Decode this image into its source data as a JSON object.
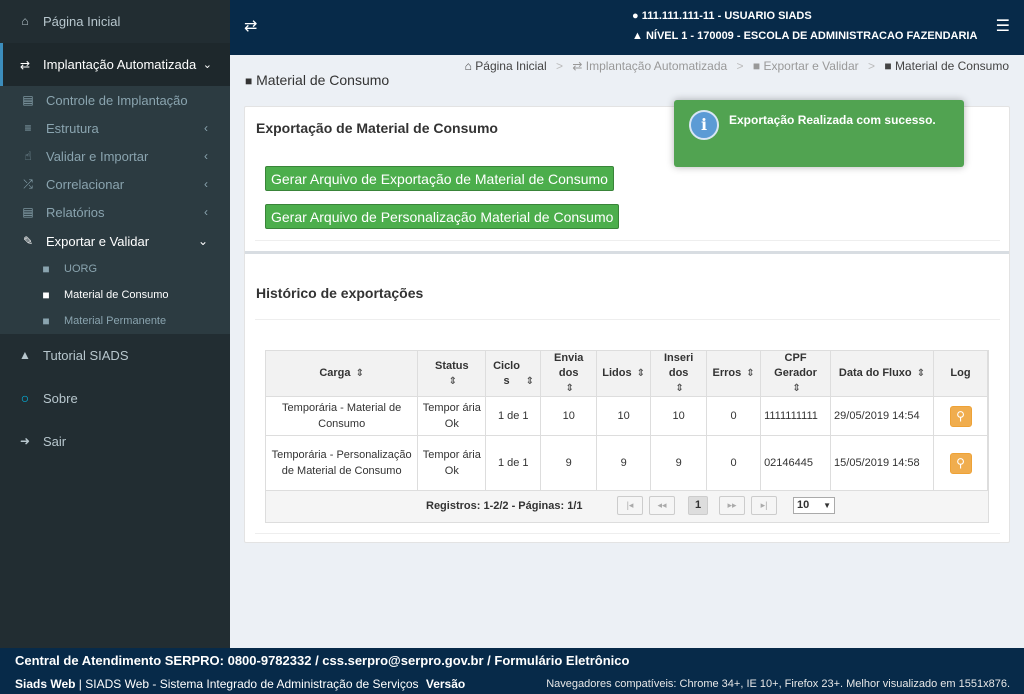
{
  "sidebar": {
    "home": "Página Inicial",
    "implantacao": "Implantação Automatizada",
    "controle": "Controle de Implantação",
    "estrutura": "Estrutura",
    "validar": "Validar e Importar",
    "correlacionar": "Correlacionar",
    "relatorios": "Relatórios",
    "exportar": "Exportar e Validar",
    "uorg": "UORG",
    "material_consumo": "Material de Consumo",
    "material_permanente": "Material Permanente",
    "tutorial": "Tutorial SIADS",
    "sobre": "Sobre",
    "sair": "Sair"
  },
  "header": {
    "user": "111.111.111-11 - USUARIO SIADS",
    "level": "NÍVEL 1 - 170009 - ESCOLA DE ADMINISTRACAO FAZENDARIA"
  },
  "page": {
    "title": "Material de Consumo",
    "breadcrumb": [
      "Página Inicial",
      "Implantação Automatizada",
      "Exportar e Validar",
      "Material de Consumo"
    ]
  },
  "export_section": {
    "title": "Exportação de Material de Consumo",
    "btn_export": "Gerar Arquivo de Exportação de Material de Consumo",
    "btn_personal": "Gerar Arquivo de Personalização Material de Consumo"
  },
  "history": {
    "title": "Histórico de exportações",
    "columns": [
      "Carga",
      "Status",
      "Ciclos",
      "Envia dos",
      "Lidos",
      "Inseri dos",
      "Erros",
      "CPF Gerador",
      "Data do Fluxo",
      "Log"
    ],
    "rows": [
      {
        "carga": "Temporária - Material de Consumo",
        "status": "Tempor ária Ok",
        "ciclos": "1 de 1",
        "enviados": "10",
        "lidos": "10",
        "inseridos": "10",
        "erros": "0",
        "cpf": "1111111111",
        "data": "29/05/2019 14:54"
      },
      {
        "carga": "Temporária - Personalização de Material de Consumo",
        "status": "Tempor ária Ok",
        "ciclos": "1 de 1",
        "enviados": "9",
        "lidos": "9",
        "inseridos": "9",
        "erros": "0",
        "cpf": "02146445",
        "data": "15/05/2019 14:58"
      }
    ],
    "pager_text": "Registros: 1-2/2 - Páginas: 1/1",
    "current_page": "1",
    "page_size": "10"
  },
  "toast": {
    "message": "Exportação Realizada com sucesso."
  },
  "footer": {
    "line1": "Central de Atendimento SERPRO: 0800-9782332 / css.serpro@serpro.gov.br / Formulário Eletrônico",
    "brand": "Siads Web",
    "desc": " | SIADS Web - Sistema Integrado de Administração de Serviços ",
    "version": "Versão",
    "browsers": "Navegadores compatíveis: Chrome 34+, IE 10+, Firefox 23+. Melhor visualizado em 1551x876."
  }
}
